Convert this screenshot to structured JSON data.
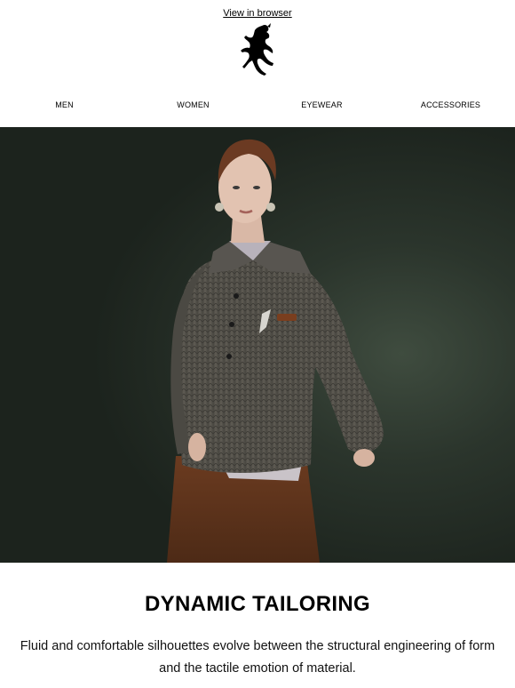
{
  "header": {
    "view_in_browser": "View in browser"
  },
  "logo": {
    "icon": "prancing-horse-icon"
  },
  "nav": {
    "items": [
      {
        "label": "MEN"
      },
      {
        "label": "WOMEN"
      },
      {
        "label": "EYEWEAR"
      },
      {
        "label": "ACCESSORIES"
      }
    ]
  },
  "hero": {
    "alt_subject": "model-in-knit-sweater-photo",
    "colors": {
      "background": "#253026",
      "sweater": "#5a5750",
      "skirt": "#6b3b20"
    }
  },
  "content": {
    "headline": "DYNAMIC TAILORING",
    "body": "Fluid and comfortable silhouettes evolve between the structural engineering of form and the tactile emotion of material."
  }
}
